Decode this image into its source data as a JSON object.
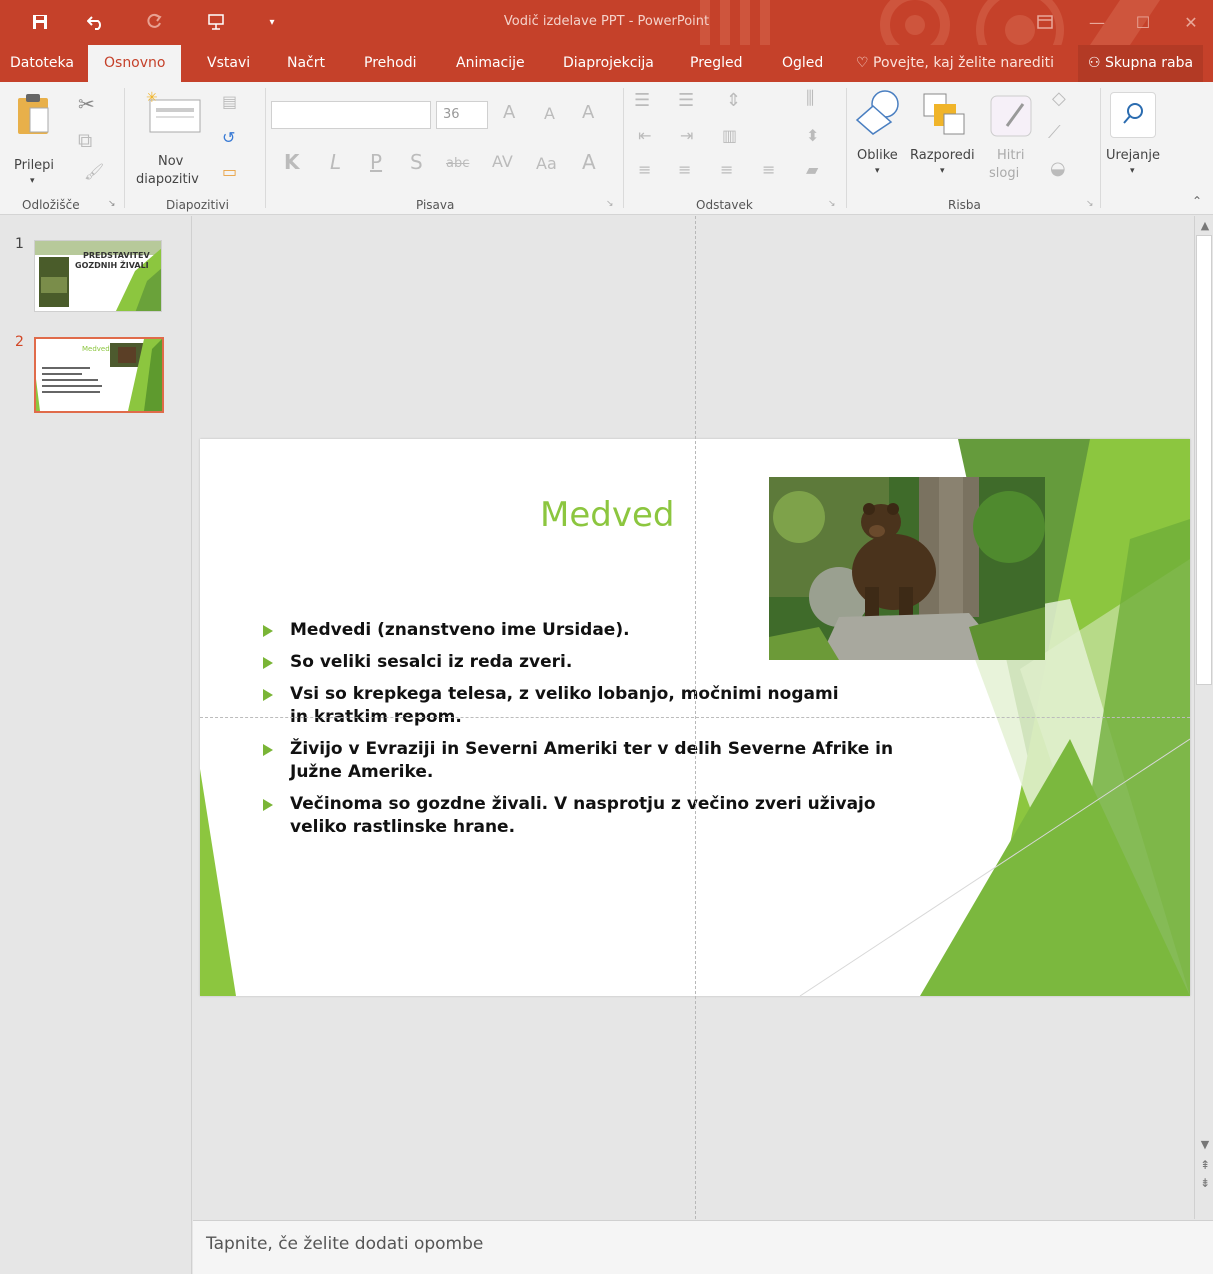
{
  "window": {
    "title": "Vodič izdelave PPT - PowerPoint",
    "controls": {
      "minimize": "—",
      "maximize": "☐",
      "close": "✕"
    }
  },
  "quick_access": {
    "save_icon": "save-icon",
    "undo_icon": "undo-icon",
    "redo_icon": "redo-icon",
    "present_icon": "start-from-beginning-icon",
    "customize_icon": "customize-qat-icon"
  },
  "tabs": [
    {
      "label": "Datoteka"
    },
    {
      "label": "Osnovno",
      "active": true
    },
    {
      "label": "Vstavi"
    },
    {
      "label": "Načrt"
    },
    {
      "label": "Prehodi"
    },
    {
      "label": "Animacije"
    },
    {
      "label": "Diaprojekcija"
    },
    {
      "label": "Pregled"
    },
    {
      "label": "Ogled"
    }
  ],
  "tell_me": "Povejte, kaj želite narediti",
  "share": "Skupna raba",
  "ribbon": {
    "groups": {
      "clipboard": "Odložišče",
      "slides": "Diapozitivi",
      "font": "Pisava",
      "paragraph": "Odstavek",
      "drawing": "Risba"
    },
    "paste_label": "Prilepi",
    "new_slide_label_1": "Nov",
    "new_slide_label_2": "diapozitiv",
    "font_size": "36",
    "font_buttons": {
      "bold": "K",
      "italic": "L",
      "underline": "P",
      "shadow": "S",
      "strikethrough": "abc",
      "spacing": "AV",
      "case": "Aa",
      "color": "A"
    },
    "shapes_label": "Oblike",
    "arrange_label": "Razporedi",
    "quick_styles_label_1": "Hitri",
    "quick_styles_label_2": "slogi",
    "editing_label": "Urejanje"
  },
  "thumbnails": [
    {
      "number": "1",
      "title_line1": "PREDSTAVITEV",
      "title_line2": "GOZDNIH ŽIVALI",
      "selected": false
    },
    {
      "number": "2",
      "title": "Medved",
      "selected": true
    }
  ],
  "slide": {
    "title": "Medved",
    "bullets": [
      "Medvedi (znanstveno ime Ursidae).",
      "So veliki sesalci iz reda zveri.",
      "Vsi so krepkega telesa, z veliko lobanjo, močnimi nogami in kratkim repom.",
      "Živijo v Evraziji in Severni Ameriki ter v delih Severne Afrike in Južne Amerike.",
      "Večinoma so gozdne živali. V nasprotju z večino zveri uživajo veliko rastlinske hrane."
    ],
    "accent_color": "#8cc63f"
  },
  "notes_placeholder": "Tapnite, če želite dodati opombe",
  "colors": {
    "titlebar": "#c5412a",
    "ribbon": "#f3f3f3",
    "workspace": "#e6e6e6",
    "slide_green": "#8cc63f"
  }
}
